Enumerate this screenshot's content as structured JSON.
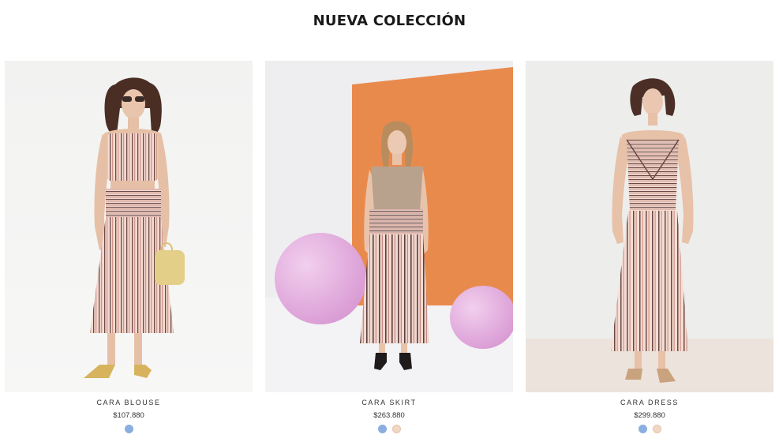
{
  "section": {
    "title": "NUEVA COLECCIÓN"
  },
  "products": [
    {
      "name": "CARA BLOUSE",
      "price": "$107.880",
      "photo_icon": "model-photo-blouse",
      "swatches": [
        "#8aaee0"
      ]
    },
    {
      "name": "CARA SKIRT",
      "price": "$263.880",
      "photo_icon": "model-photo-skirt",
      "swatches": [
        "#8aaee0",
        "#f1d8c4"
      ]
    },
    {
      "name": "CARA DRESS",
      "price": "$299.880",
      "photo_icon": "model-photo-dress",
      "swatches": [
        "#8aaee0",
        "#f1d8c4"
      ]
    }
  ]
}
